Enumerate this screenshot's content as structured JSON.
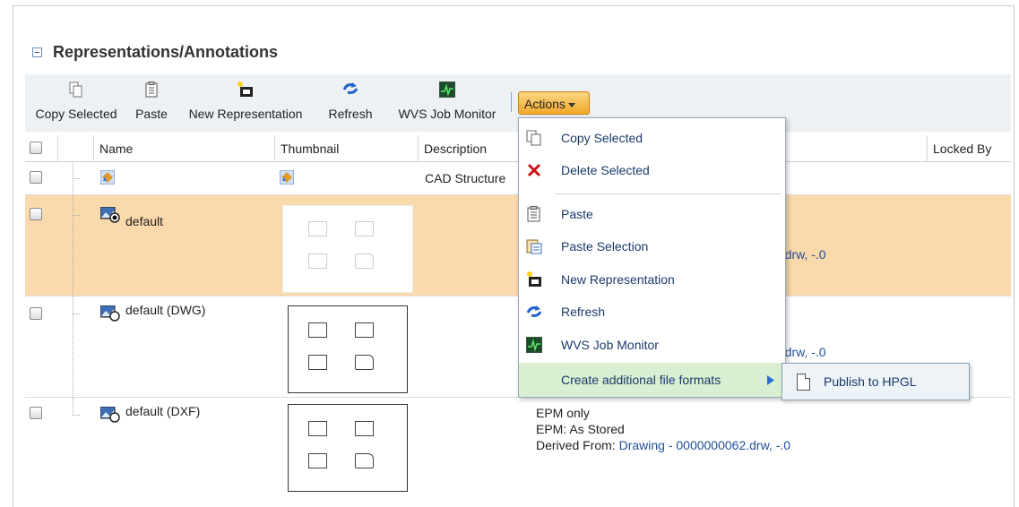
{
  "section": {
    "title": "Representations/Annotations"
  },
  "toolbar": {
    "copy_selected": "Copy Selected",
    "paste": "Paste",
    "new_representation": "New Representation",
    "refresh": "Refresh",
    "wvs_job_monitor": "WVS Job Monitor",
    "actions": "Actions"
  },
  "table": {
    "headers": {
      "name": "Name",
      "thumbnail": "Thumbnail",
      "description": "Description",
      "locked_by": "Locked By"
    },
    "rows": [
      {
        "name": "",
        "description": "CAD Structure"
      },
      {
        "name": "default",
        "selected": true,
        "file_tail": "2.drw, -.0"
      },
      {
        "name": "default (DWG)",
        "file_tail": "2.drw, -.0"
      },
      {
        "name": "default (DXF)",
        "desc_line1": "EPM only",
        "desc_line2": "EPM: As Stored",
        "derived_prefix": "Derived From: ",
        "derived_link": "Drawing - 0000000062.drw, -.0"
      }
    ]
  },
  "actions_menu": {
    "items": [
      {
        "label": "Copy Selected",
        "icon": "copy-icon"
      },
      {
        "label": "Delete Selected",
        "icon": "delete-icon"
      },
      {
        "label": "Paste",
        "icon": "paste-icon"
      },
      {
        "label": "Paste Selection",
        "icon": "paste-selection-icon"
      },
      {
        "label": "New Representation",
        "icon": "new-representation-icon"
      },
      {
        "label": "Refresh",
        "icon": "refresh-icon"
      },
      {
        "label": "WVS Job Monitor",
        "icon": "wvs-monitor-icon"
      },
      {
        "label": "Create additional file formats",
        "icon": "submenu-arrow-icon"
      }
    ],
    "submenu": {
      "label": "Publish to HPGL",
      "icon": "page-icon"
    }
  },
  "colors": {
    "selected_row": "#fad9ac",
    "actions_button": "#f1a928",
    "menu_highlight": "#d8efd2",
    "link": "#1f4f98"
  }
}
